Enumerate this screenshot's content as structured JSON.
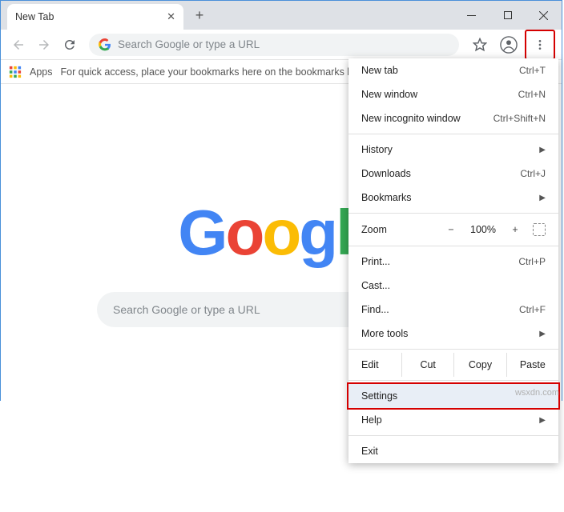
{
  "tab": {
    "title": "New Tab"
  },
  "omnibox": {
    "placeholder": "Search Google or type a URL"
  },
  "bookbar": {
    "apps": "Apps",
    "hint": "For quick access, place your bookmarks here on the bookmarks ba"
  },
  "page": {
    "logo": "Google",
    "search_placeholder": "Search Google or type a URL"
  },
  "menu": {
    "new_tab": {
      "label": "New tab",
      "short": "Ctrl+T"
    },
    "new_window": {
      "label": "New window",
      "short": "Ctrl+N"
    },
    "incognito": {
      "label": "New incognito window",
      "short": "Ctrl+Shift+N"
    },
    "history": {
      "label": "History"
    },
    "downloads": {
      "label": "Downloads",
      "short": "Ctrl+J"
    },
    "bookmarks": {
      "label": "Bookmarks"
    },
    "zoom": {
      "label": "Zoom",
      "value": "100%"
    },
    "print": {
      "label": "Print...",
      "short": "Ctrl+P"
    },
    "cast": {
      "label": "Cast..."
    },
    "find": {
      "label": "Find...",
      "short": "Ctrl+F"
    },
    "more_tools": {
      "label": "More tools"
    },
    "edit": {
      "label": "Edit",
      "cut": "Cut",
      "copy": "Copy",
      "paste": "Paste"
    },
    "settings": {
      "label": "Settings"
    },
    "help": {
      "label": "Help"
    },
    "exit": {
      "label": "Exit"
    }
  },
  "watermark": "wsxdn.com"
}
